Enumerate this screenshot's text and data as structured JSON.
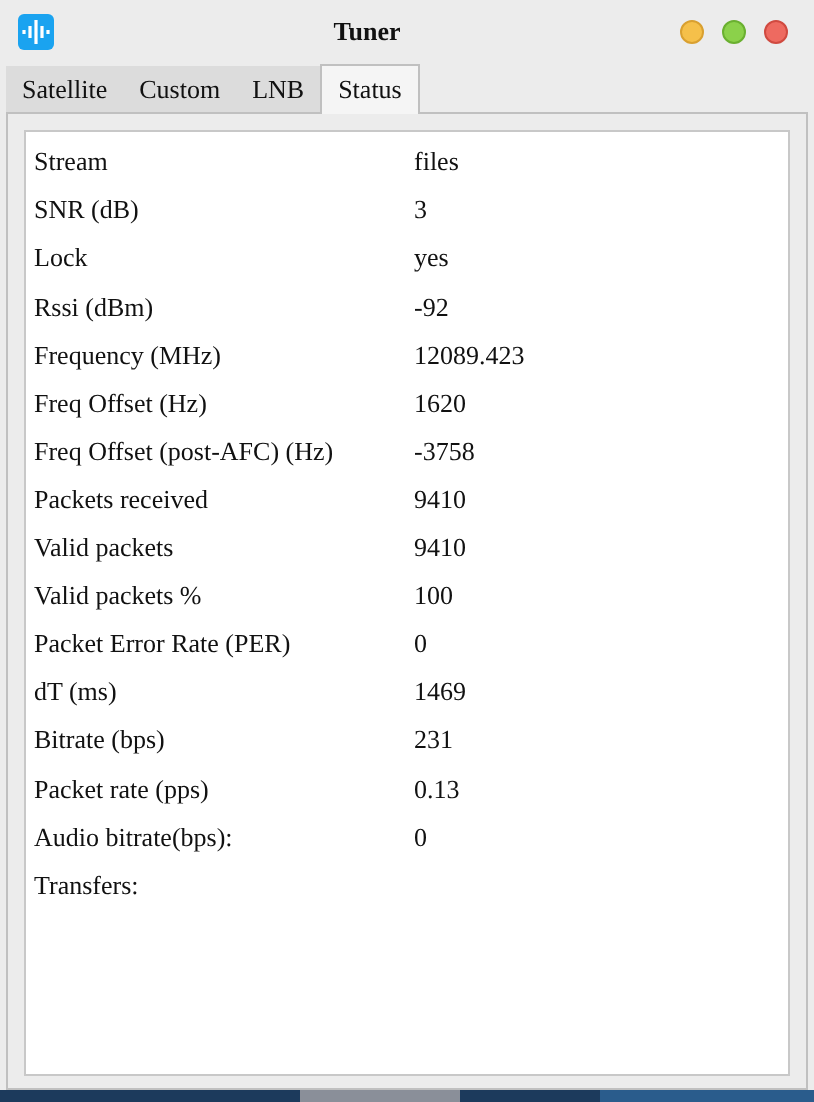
{
  "window": {
    "title": "Tuner"
  },
  "tabs": [
    {
      "label": "Satellite",
      "selected": false
    },
    {
      "label": "Custom",
      "selected": false
    },
    {
      "label": "LNB",
      "selected": false
    },
    {
      "label": "Status",
      "selected": true
    }
  ],
  "status": [
    {
      "label": "Stream",
      "value": "files"
    },
    {
      "label": "SNR (dB)",
      "value": "3"
    },
    {
      "label": "Lock",
      "value": "yes"
    },
    {
      "label": "Rssi (dBm)",
      "value": "-92"
    },
    {
      "label": "Frequency (MHz)",
      "value": "12089.423"
    },
    {
      "label": "Freq Offset (Hz)",
      "value": "1620"
    },
    {
      "label": "Freq Offset (post-AFC) (Hz)",
      "value": "-3758"
    },
    {
      "label": "Packets received",
      "value": "9410"
    },
    {
      "label": "Valid packets",
      "value": "9410"
    },
    {
      "label": "Valid packets %",
      "value": "100"
    },
    {
      "label": "Packet Error Rate (PER)",
      "value": "0"
    },
    {
      "label": "dT (ms)",
      "value": "1469"
    },
    {
      "label": "Bitrate (bps)",
      "value": "231"
    },
    {
      "label": "Packet rate (pps)",
      "value": "0.13"
    },
    {
      "label": "Audio bitrate(bps):",
      "value": "0"
    },
    {
      "label": "Transfers:"
    }
  ]
}
